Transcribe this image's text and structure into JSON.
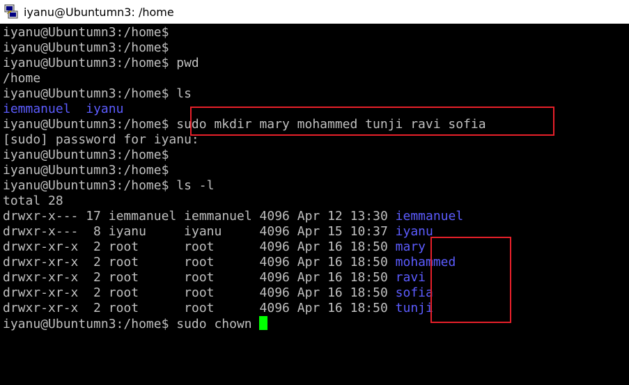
{
  "window": {
    "title": "iyanu@Ubuntumn3: /home",
    "icon": "putty-icon"
  },
  "terminal": {
    "prompt": "iyanu@Ubuntumn3:/home$",
    "lines": [
      {
        "prompt": "iyanu@Ubuntumn3:/home$",
        "command": ""
      },
      {
        "prompt": "iyanu@Ubuntumn3:/home$",
        "command": ""
      },
      {
        "prompt": "iyanu@Ubuntumn3:/home$",
        "command": " pwd"
      },
      {
        "output": "/home"
      },
      {
        "prompt": "iyanu@Ubuntumn3:/home$",
        "command": " ls"
      },
      {
        "dirs": [
          "iemmanuel",
          "iyanu"
        ]
      },
      {
        "prompt": "iyanu@Ubuntumn3:/home$",
        "command": " sudo mkdir mary mohammed tunji ravi sofia"
      },
      {
        "output": "[sudo] password for iyanu:"
      },
      {
        "prompt": "iyanu@Ubuntumn3:/home$",
        "command": ""
      },
      {
        "prompt": "iyanu@Ubuntumn3:/home$",
        "command": ""
      },
      {
        "prompt": "iyanu@Ubuntumn3:/home$",
        "command": " ls -l"
      },
      {
        "output": "total 28"
      }
    ],
    "listing": [
      {
        "perms": "drwxr-x---",
        "links": "17",
        "owner": "iemmanuel",
        "group": "iemmanuel",
        "size": "4096",
        "month": "Apr",
        "day": "12",
        "time": "13:30",
        "name": "iemmanuel"
      },
      {
        "perms": "drwxr-x---",
        "links": " 8",
        "owner": "iyanu    ",
        "group": "iyanu    ",
        "size": "4096",
        "month": "Apr",
        "day": "15",
        "time": "10:37",
        "name": "iyanu"
      },
      {
        "perms": "drwxr-xr-x",
        "links": " 2",
        "owner": "root     ",
        "group": "root     ",
        "size": "4096",
        "month": "Apr",
        "day": "16",
        "time": "18:50",
        "name": "mary"
      },
      {
        "perms": "drwxr-xr-x",
        "links": " 2",
        "owner": "root     ",
        "group": "root     ",
        "size": "4096",
        "month": "Apr",
        "day": "16",
        "time": "18:50",
        "name": "mohammed"
      },
      {
        "perms": "drwxr-xr-x",
        "links": " 2",
        "owner": "root     ",
        "group": "root     ",
        "size": "4096",
        "month": "Apr",
        "day": "16",
        "time": "18:50",
        "name": "ravi"
      },
      {
        "perms": "drwxr-xr-x",
        "links": " 2",
        "owner": "root     ",
        "group": "root     ",
        "size": "4096",
        "month": "Apr",
        "day": "16",
        "time": "18:50",
        "name": "sofia"
      },
      {
        "perms": "drwxr-xr-x",
        "links": " 2",
        "owner": "root     ",
        "group": "root     ",
        "size": "4096",
        "month": "Apr",
        "day": "16",
        "time": "18:50",
        "name": "tunji"
      }
    ],
    "current_input": " sudo chown ",
    "colors": {
      "text": "#c0c0c0",
      "directory": "#5c5cff",
      "cursor": "#00ff00",
      "highlight": "#e8202a"
    }
  }
}
